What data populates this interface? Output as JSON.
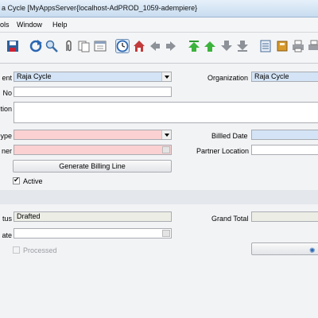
{
  "window": {
    "title": "a Cycle [MyAppsServer{localhost-AdPROD_1059-adempiere}"
  },
  "menu": {
    "items": [
      "ols",
      "Window",
      "Help"
    ]
  },
  "toolbar": {
    "icons": [
      "save-icon",
      "refresh-icon",
      "find-icon",
      "attachment-icon",
      "copy-icon",
      "report-icon",
      "history-icon",
      "home-icon",
      "back-icon",
      "forward-icon",
      "first-record-icon",
      "previous-record-icon",
      "next-record-icon",
      "last-record-icon",
      "detail-icon",
      "archive-icon",
      "print-icon",
      "print-preview-icon"
    ]
  },
  "form": {
    "client_label": "ent",
    "client_value": "Raja Cycle",
    "organization_label": "Organization",
    "organization_value": "Raja Cycle",
    "no_label": "No",
    "no_value": "",
    "description_label": "tion",
    "description_value": "",
    "type_label": "ype",
    "type_value": "",
    "billed_date_label": "Billled Date",
    "billed_date_value": "",
    "partner_label": "ner",
    "partner_value": "",
    "partner_location_label": "Partner Location",
    "partner_location_value": "",
    "generate_button": "Generate Billing Line",
    "active_label": "Active",
    "status_label": "tus",
    "status_value": "Drafted",
    "grand_total_label": "Grand Total",
    "grand_total_value": "",
    "date_label": "ate",
    "date_value": "",
    "processed_label": "Processed"
  },
  "colors": {
    "mandatory": "#fbd1d1",
    "highlight": "#d4e4f6",
    "readonly": "#eceee6"
  }
}
